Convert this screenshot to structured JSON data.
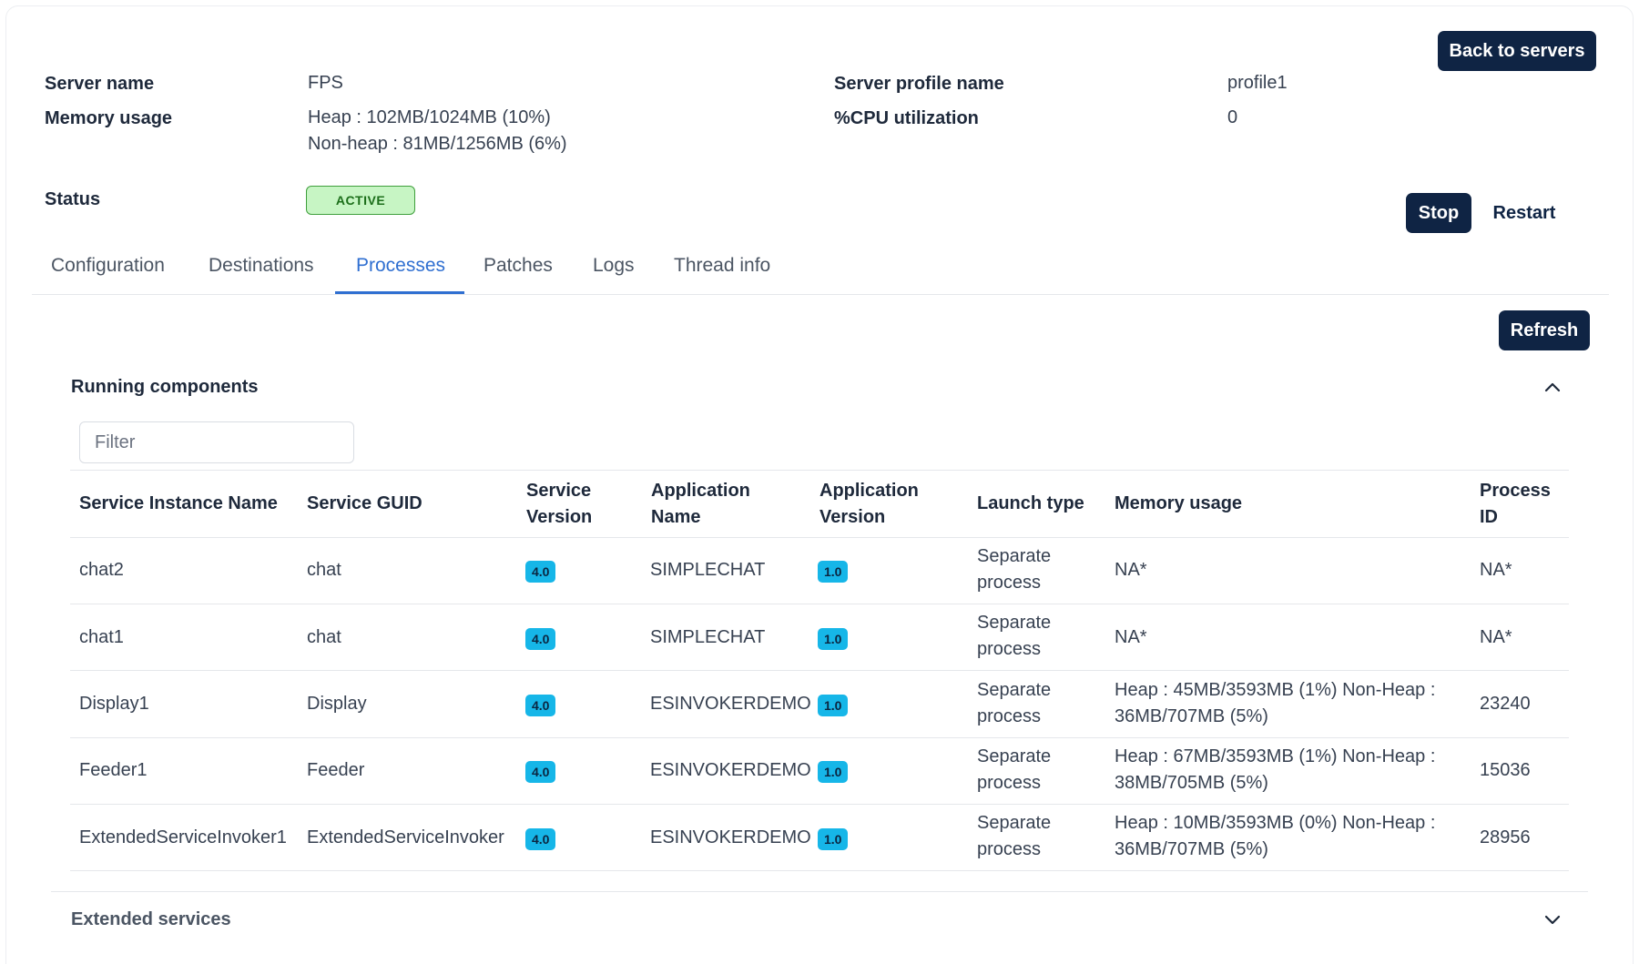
{
  "header": {
    "server_name_label": "Server name",
    "server_name_value": "FPS",
    "memory_usage_label": "Memory usage",
    "memory_heap": "Heap : 102MB/1024MB (10%)",
    "memory_nonheap": "Non-heap : 81MB/1256MB (6%)",
    "profile_label": "Server profile name",
    "profile_value": "profile1",
    "cpu_label": "%CPU utilization",
    "cpu_value": "0",
    "status_label": "Status",
    "status_value": "ACTIVE",
    "back_button": "Back to servers",
    "stop_button": "Stop",
    "restart_button": "Restart"
  },
  "tabs": [
    {
      "label": "Configuration",
      "active": false
    },
    {
      "label": "Destinations",
      "active": false
    },
    {
      "label": "Processes",
      "active": true
    },
    {
      "label": "Patches",
      "active": false
    },
    {
      "label": "Logs",
      "active": false
    },
    {
      "label": "Thread info",
      "active": false
    }
  ],
  "refresh_button": "Refresh",
  "running": {
    "title": "Running components",
    "filter_placeholder": "Filter",
    "columns": {
      "instance": "Service Instance Name",
      "guid": "Service GUID",
      "service_version_1": "Service",
      "service_version_2": "Version",
      "app_name_1": "Application",
      "app_name_2": "Name",
      "app_version_1": "Application",
      "app_version_2": "Version",
      "launch": "Launch type",
      "memory": "Memory usage",
      "pid_1": "Process",
      "pid_2": "ID"
    },
    "rows": [
      {
        "instance": "chat2",
        "guid": "chat",
        "service_version": "4.0",
        "app_name": "SIMPLECHAT",
        "app_version": "1.0",
        "launch_1": "Separate",
        "launch_2": "process",
        "memory_1": "NA*",
        "memory_2": "",
        "pid": "NA*"
      },
      {
        "instance": "chat1",
        "guid": "chat",
        "service_version": "4.0",
        "app_name": "SIMPLECHAT",
        "app_version": "1.0",
        "launch_1": "Separate",
        "launch_2": "process",
        "memory_1": "NA*",
        "memory_2": "",
        "pid": "NA*"
      },
      {
        "instance": "Display1",
        "guid": "Display",
        "service_version": "4.0",
        "app_name": "ESINVOKERDEMO",
        "app_version": "1.0",
        "launch_1": "Separate",
        "launch_2": "process",
        "memory_1": "Heap : 45MB/3593MB (1%) Non-Heap :",
        "memory_2": "36MB/707MB (5%)",
        "pid": "23240"
      },
      {
        "instance": "Feeder1",
        "guid": "Feeder",
        "service_version": "4.0",
        "app_name": "ESINVOKERDEMO",
        "app_version": "1.0",
        "launch_1": "Separate",
        "launch_2": "process",
        "memory_1": "Heap : 67MB/3593MB (1%) Non-Heap :",
        "memory_2": "38MB/705MB (5%)",
        "pid": "15036"
      },
      {
        "instance": "ExtendedServiceInvoker1",
        "guid": "ExtendedServiceInvoker",
        "service_version": "4.0",
        "app_name": "ESINVOKERDEMO",
        "app_version": "1.0",
        "launch_1": "Separate",
        "launch_2": "process",
        "memory_1": "Heap : 10MB/3593MB (0%) Non-Heap :",
        "memory_2": "36MB/707MB (5%)",
        "pid": "28956"
      }
    ]
  },
  "extended": {
    "title": "Extended services"
  },
  "icons": {
    "collapse": "chevron-up-icon",
    "expand": "chevron-down-icon"
  },
  "colors": {
    "primary_dark": "#0f2444",
    "tab_active": "#2f6fd1",
    "status_bg": "#c7f5c4",
    "status_text": "#1c6e1a",
    "version_badge": "#16b6e8"
  }
}
